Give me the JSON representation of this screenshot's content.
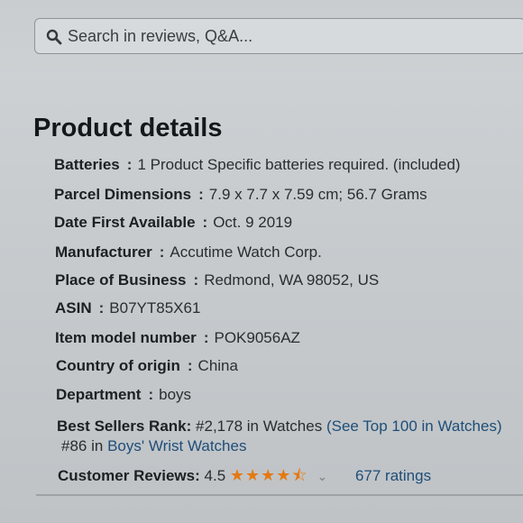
{
  "search": {
    "placeholder": "Search in reviews, Q&A..."
  },
  "section_title": "Product details",
  "details": [
    {
      "label": "Batteries",
      "sep": ":",
      "value": "1 Product Specific batteries required. (included)"
    },
    {
      "label": "Parcel Dimensions",
      "sep": ":",
      "value": "7.9 x 7.7 x 7.59 cm; 56.7 Grams"
    },
    {
      "label": "Date First Available",
      "sep": ":",
      "value": "Oct. 9 2019"
    },
    {
      "label": "Manufacturer",
      "sep": ":",
      "value": "Accutime Watch Corp."
    },
    {
      "label": "Place of Business",
      "sep": ":",
      "value": "Redmond, WA 98052, US"
    },
    {
      "label": "ASIN",
      "sep": ":",
      "value": "B07YT85X61"
    },
    {
      "label": "Item model number",
      "sep": ":",
      "value": "POK9056AZ"
    },
    {
      "label": "Country of origin",
      "sep": ":",
      "value": "China"
    },
    {
      "label": "Department",
      "sep": ":",
      "value": "boys"
    }
  ],
  "best_sellers": {
    "label": "Best Sellers Rank:",
    "rank1": "#2,178 in Watches",
    "link1": "(See Top 100 in Watches)",
    "rank2_prefix": "#86 in",
    "link2": "Boys' Wrist Watches"
  },
  "customer_reviews": {
    "label": "Customer Reviews:",
    "rating": "4.5",
    "stars": "★★★★⯪",
    "ratings_count": "677 ratings"
  },
  "colors": {
    "link": "#1f4e78",
    "star": "#e47911"
  }
}
